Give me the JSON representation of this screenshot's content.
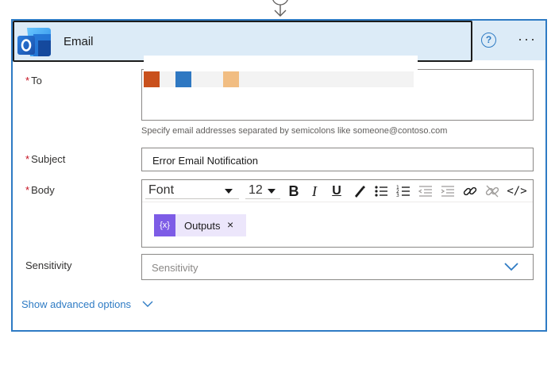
{
  "header": {
    "title": "Email",
    "help_label": "?",
    "more_label": "···"
  },
  "colors": {
    "accent": "#2e7bc4",
    "header_bg": "#dcebf7",
    "required": "#c50f1f",
    "token_purple": "#7d5ce6",
    "recipient_tokens": [
      "#c9501c",
      "#2f78c2",
      "#f1bd82"
    ]
  },
  "fields": {
    "to": {
      "required_mark": "*",
      "label": "To",
      "hint": "Specify email addresses separated by semicolons like someone@contoso.com"
    },
    "subject": {
      "required_mark": "*",
      "label": "Subject",
      "value": "Error Email Notification"
    },
    "body": {
      "required_mark": "*",
      "label": "Body",
      "font": "Font",
      "font_size": "12",
      "toolbar": {
        "bold": "B",
        "italic": "I",
        "underline": "U",
        "code": "</>"
      },
      "token": {
        "icon": "{x}",
        "label": "Outputs",
        "close": "×"
      }
    },
    "sensitivity": {
      "label": "Sensitivity",
      "placeholder": "Sensitivity"
    }
  },
  "advanced": {
    "label": "Show advanced options"
  },
  "icons": [
    "connector-arrow-icon",
    "outlook-icon",
    "help-icon",
    "more-icon",
    "text-color-icon",
    "bullet-list-icon",
    "numbered-list-icon",
    "decrease-indent-icon",
    "increase-indent-icon",
    "link-icon",
    "unlink-icon",
    "code-view-icon",
    "chevron-down-icon"
  ]
}
